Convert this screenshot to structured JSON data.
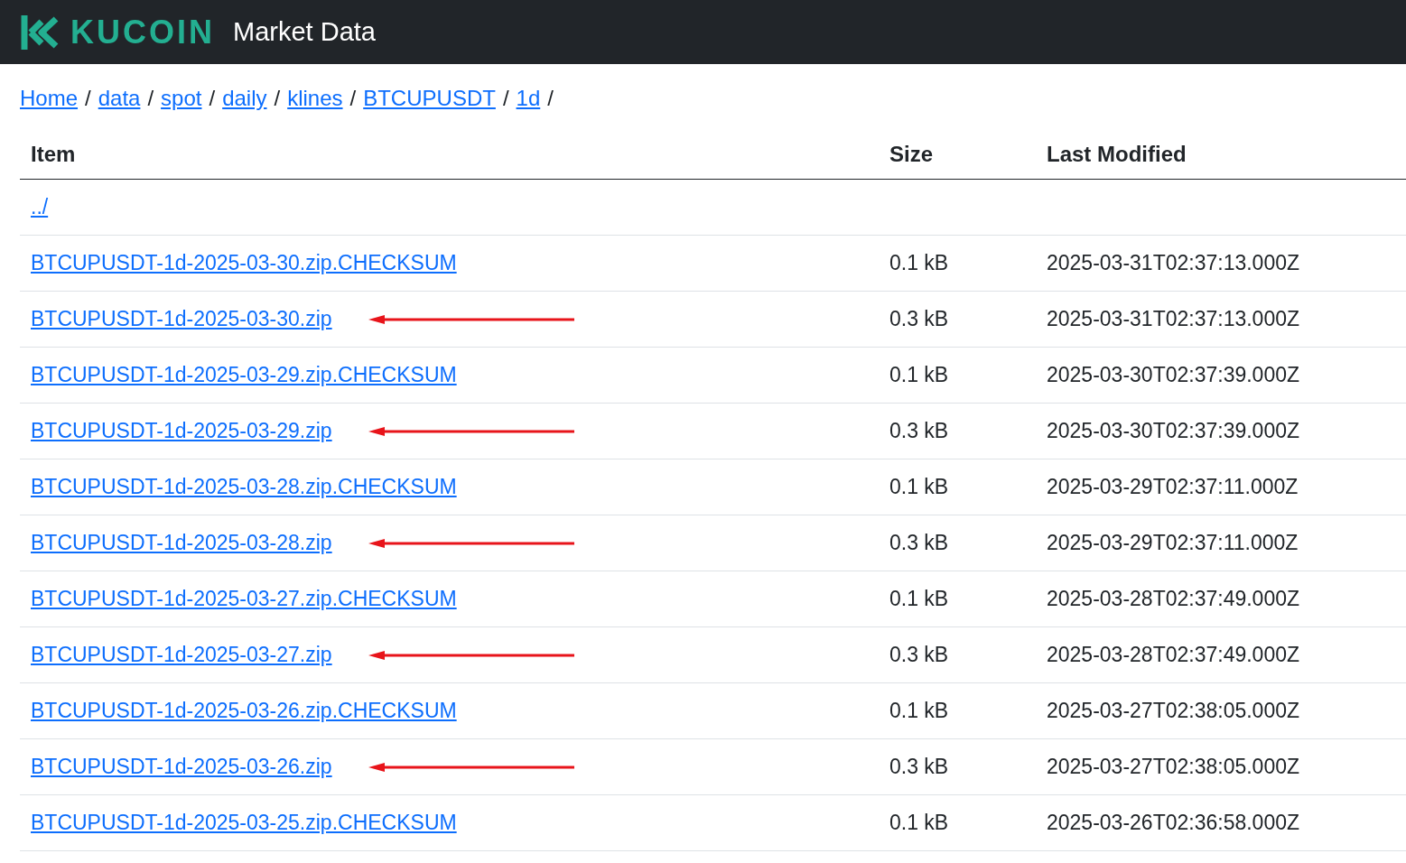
{
  "header": {
    "logo_text": "KUCOIN",
    "title": "Market Data"
  },
  "breadcrumb": {
    "separator": "/",
    "items": [
      "Home",
      "data",
      "spot",
      "daily",
      "klines",
      "BTCUPUSDT",
      "1d"
    ]
  },
  "table": {
    "columns": [
      "Item",
      "Size",
      "Last Modified"
    ],
    "rows": [
      {
        "item": "../",
        "size": "",
        "modified": "",
        "arrow": false
      },
      {
        "item": "BTCUPUSDT-1d-2025-03-30.zip.CHECKSUM",
        "size": "0.1 kB",
        "modified": "2025-03-31T02:37:13.000Z",
        "arrow": false
      },
      {
        "item": "BTCUPUSDT-1d-2025-03-30.zip",
        "size": "0.3 kB",
        "modified": "2025-03-31T02:37:13.000Z",
        "arrow": true
      },
      {
        "item": "BTCUPUSDT-1d-2025-03-29.zip.CHECKSUM",
        "size": "0.1 kB",
        "modified": "2025-03-30T02:37:39.000Z",
        "arrow": false
      },
      {
        "item": "BTCUPUSDT-1d-2025-03-29.zip",
        "size": "0.3 kB",
        "modified": "2025-03-30T02:37:39.000Z",
        "arrow": true
      },
      {
        "item": "BTCUPUSDT-1d-2025-03-28.zip.CHECKSUM",
        "size": "0.1 kB",
        "modified": "2025-03-29T02:37:11.000Z",
        "arrow": false
      },
      {
        "item": "BTCUPUSDT-1d-2025-03-28.zip",
        "size": "0.3 kB",
        "modified": "2025-03-29T02:37:11.000Z",
        "arrow": true
      },
      {
        "item": "BTCUPUSDT-1d-2025-03-27.zip.CHECKSUM",
        "size": "0.1 kB",
        "modified": "2025-03-28T02:37:49.000Z",
        "arrow": false
      },
      {
        "item": "BTCUPUSDT-1d-2025-03-27.zip",
        "size": "0.3 kB",
        "modified": "2025-03-28T02:37:49.000Z",
        "arrow": true
      },
      {
        "item": "BTCUPUSDT-1d-2025-03-26.zip.CHECKSUM",
        "size": "0.1 kB",
        "modified": "2025-03-27T02:38:05.000Z",
        "arrow": false
      },
      {
        "item": "BTCUPUSDT-1d-2025-03-26.zip",
        "size": "0.3 kB",
        "modified": "2025-03-27T02:38:05.000Z",
        "arrow": true
      },
      {
        "item": "BTCUPUSDT-1d-2025-03-25.zip.CHECKSUM",
        "size": "0.1 kB",
        "modified": "2025-03-26T02:36:58.000Z",
        "arrow": false
      }
    ]
  }
}
